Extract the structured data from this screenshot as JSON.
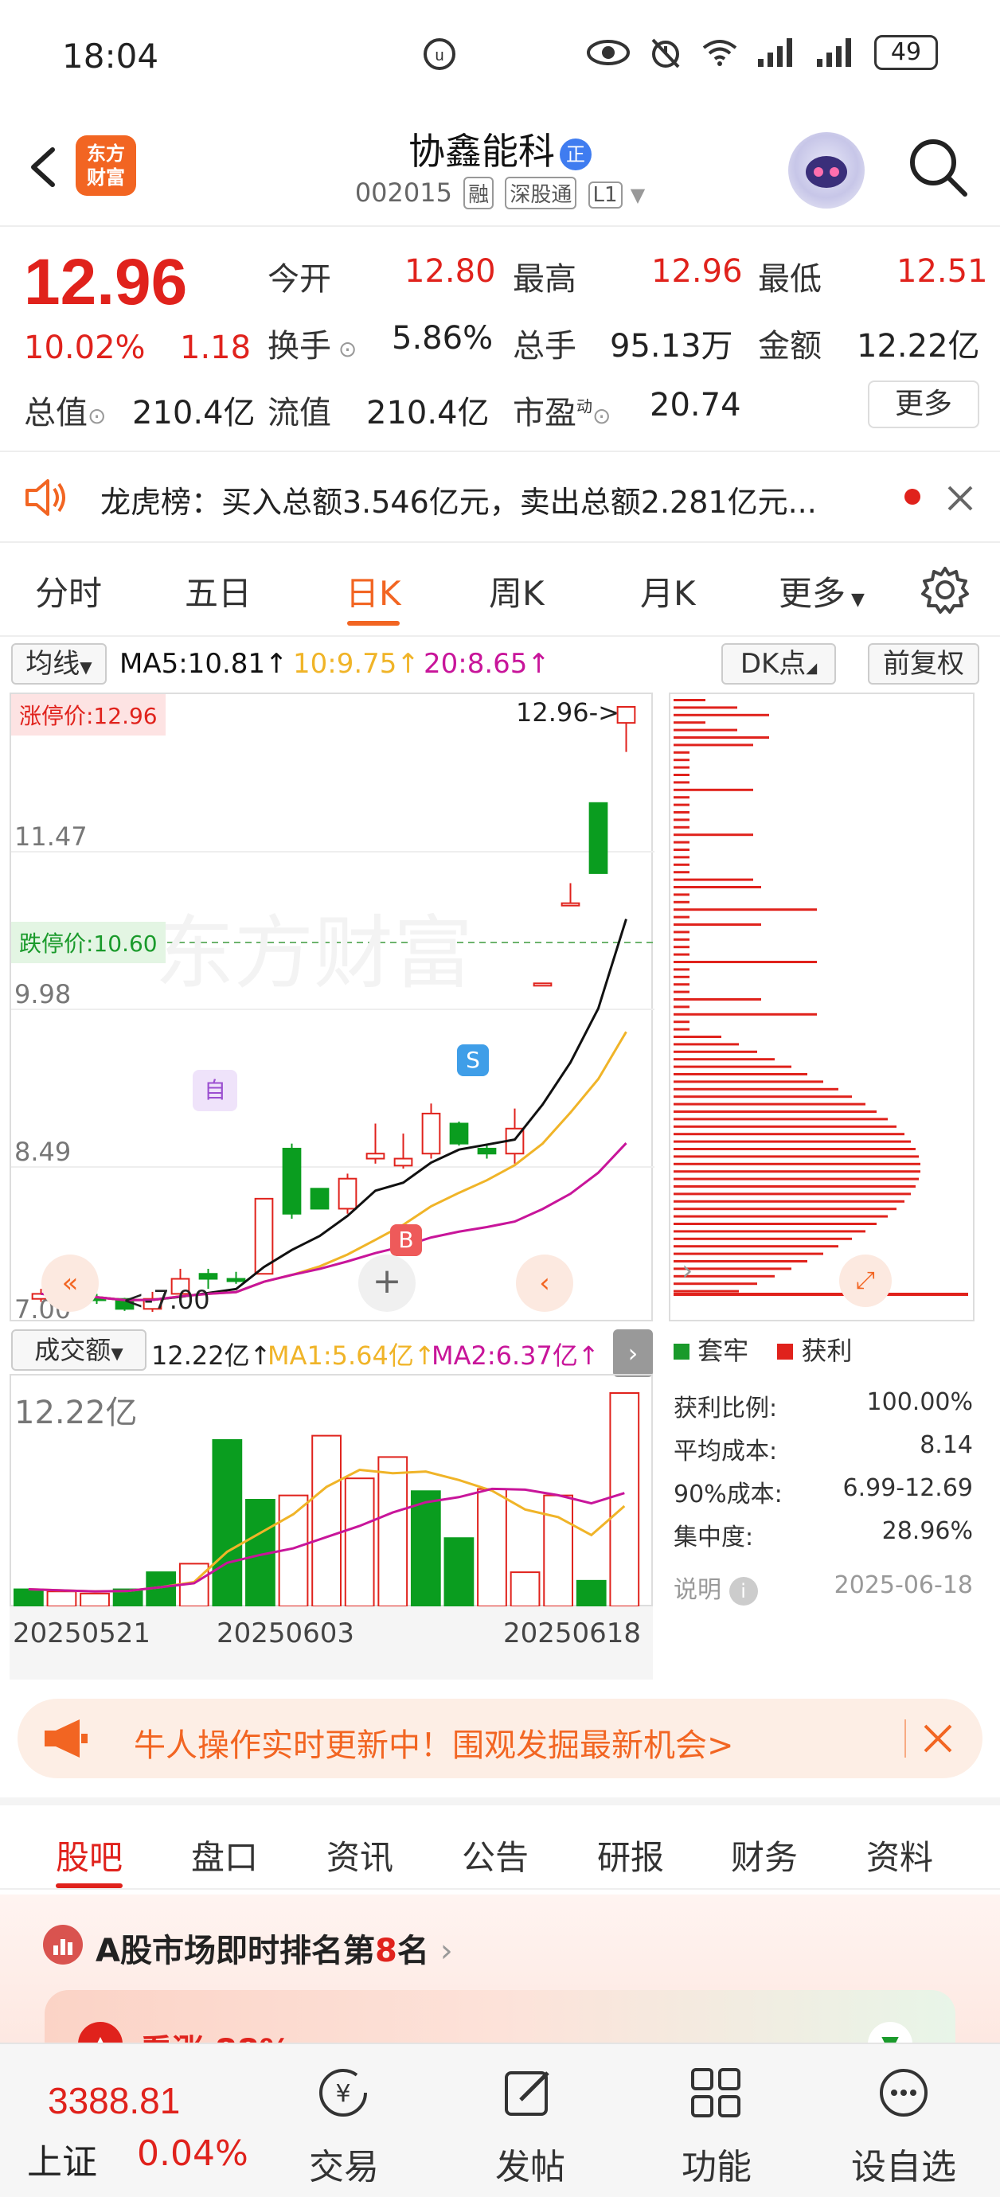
{
  "status_bar": {
    "time": "18:04",
    "battery": "49"
  },
  "header": {
    "logo_line1": "东方",
    "logo_line2": "财富",
    "stock_name": "协鑫能科",
    "name_badge": "正",
    "code": "002015",
    "chips": [
      "融",
      "深股通",
      "L1"
    ]
  },
  "quote": {
    "price": "12.96",
    "change_pct": "10.02%",
    "change": "1.18",
    "open_label": "今开",
    "open": "12.80",
    "high_label": "最高",
    "high": "12.96",
    "low_label": "最低",
    "low": "12.51",
    "turnover_label": "换手",
    "turnover": "5.86%",
    "volume_label": "总手",
    "volume": "95.13万",
    "amount_label": "金额",
    "amount": "12.22亿",
    "mktcap_label": "总值",
    "mktcap": "210.4亿",
    "float_label": "流值",
    "float": "210.4亿",
    "pe_label": "市盈",
    "pe_sup": "动",
    "pe": "20.74",
    "more_label": "更多"
  },
  "notice": {
    "text": "龙虎榜：买入总额3.546亿元，卖出总额2.281亿元..."
  },
  "chart_tabs": [
    "分时",
    "五日",
    "日K",
    "周K",
    "月K",
    "更多"
  ],
  "active_chart_tab": "日K",
  "indicators": {
    "selector": "均线",
    "ma5": "MA5:10.81",
    "ma10": "10:9.75",
    "ma20": "20:8.65",
    "dk": "DK点",
    "adjust": "前复权"
  },
  "price_chart": {
    "limit_up_label": "涨停价:12.96",
    "limit_down_label": "跌停价:10.60",
    "y_ticks": [
      "11.47",
      "9.98",
      "8.49",
      "7.00"
    ],
    "max_marker": "12.96->",
    "min_marker": "<-7.00",
    "watermark": "东方财富",
    "marker_zi": "自",
    "marker_s": "S",
    "marker_b": "B"
  },
  "chart_data": {
    "type": "candlestick",
    "y_range": [
      7.0,
      12.96
    ],
    "candles": [
      {
        "o": 7.05,
        "c": 7.1,
        "h": 7.15,
        "l": 7.02
      },
      {
        "o": 7.08,
        "c": 7.06,
        "h": 7.12,
        "l": 7.0
      },
      {
        "o": 7.06,
        "c": 7.04,
        "h": 7.1,
        "l": 7.0
      },
      {
        "o": 7.05,
        "c": 6.95,
        "h": 7.06,
        "l": 6.93
      },
      {
        "o": 6.95,
        "c": 7.05,
        "h": 7.12,
        "l": 6.92
      },
      {
        "o": 7.1,
        "c": 7.25,
        "h": 7.35,
        "l": 7.05
      },
      {
        "o": 7.3,
        "c": 7.25,
        "h": 7.35,
        "l": 7.15
      },
      {
        "o": 7.25,
        "c": 7.24,
        "h": 7.32,
        "l": 7.2
      },
      {
        "o": 7.3,
        "c": 8.05,
        "h": 8.05,
        "l": 7.3
      },
      {
        "o": 8.55,
        "c": 7.9,
        "h": 8.6,
        "l": 7.85
      },
      {
        "o": 8.15,
        "c": 7.95,
        "h": 8.15,
        "l": 7.95
      },
      {
        "o": 7.95,
        "c": 8.25,
        "h": 8.3,
        "l": 7.9
      },
      {
        "o": 8.45,
        "c": 8.5,
        "h": 8.8,
        "l": 8.4
      },
      {
        "o": 8.38,
        "c": 8.45,
        "h": 8.7,
        "l": 8.35
      },
      {
        "o": 8.5,
        "c": 8.9,
        "h": 9.0,
        "l": 8.45
      },
      {
        "o": 8.8,
        "c": 8.6,
        "h": 8.82,
        "l": 8.58
      },
      {
        "o": 8.55,
        "c": 8.5,
        "h": 8.58,
        "l": 8.45
      },
      {
        "o": 8.5,
        "c": 8.75,
        "h": 8.95,
        "l": 8.4
      },
      {
        "o": 10.2,
        "c": 10.2,
        "h": 10.2,
        "l": 10.2
      },
      {
        "o": 11.0,
        "c": 11.0,
        "h": 11.2,
        "l": 11.0
      },
      {
        "o": 12.0,
        "c": 11.3,
        "h": 12.0,
        "l": 11.3
      },
      {
        "o": 12.8,
        "c": 12.96,
        "h": 12.96,
        "l": 12.51
      }
    ]
  },
  "volume_chart": {
    "selector": "成交额",
    "amount": "12.22亿",
    "ma1": "MA1:5.64亿",
    "ma2": "MA2:6.37亿",
    "top_label": "12.22亿",
    "dates": [
      "20250521",
      "20250603",
      "20250618"
    ]
  },
  "distribution": {
    "legend_trap": "套牢",
    "legend_profit": "获利",
    "profit_ratio_label": "获利比例:",
    "profit_ratio": "100.00%",
    "avg_cost_label": "平均成本:",
    "avg_cost": "8.14",
    "cost90_label": "90%成本:",
    "cost90": "6.99-12.69",
    "concentration_label": "集中度:",
    "concentration": "28.96%",
    "note_label": "说明",
    "date": "2025-06-18"
  },
  "banner": {
    "text": "牛人操作实时更新中！围观发掘最新机会>"
  },
  "bottom_tabs": [
    "股吧",
    "盘口",
    "资讯",
    "公告",
    "研报",
    "财务",
    "资料"
  ],
  "rank": {
    "prefix": "A股市场即时排名第",
    "num": "8",
    "suffix": "名",
    "card_text": "看涨 88%"
  },
  "footer": {
    "index_value": "3388.81",
    "index_name": "上证",
    "index_pct": "0.04%",
    "items": [
      "交易",
      "发帖",
      "功能",
      "设自选"
    ]
  },
  "colors": {
    "up": "#e0221c",
    "down": "#0a9d1f",
    "accent": "#f26522",
    "ma5": "#111111",
    "ma10": "#f0b428",
    "ma20": "#c8159a"
  }
}
